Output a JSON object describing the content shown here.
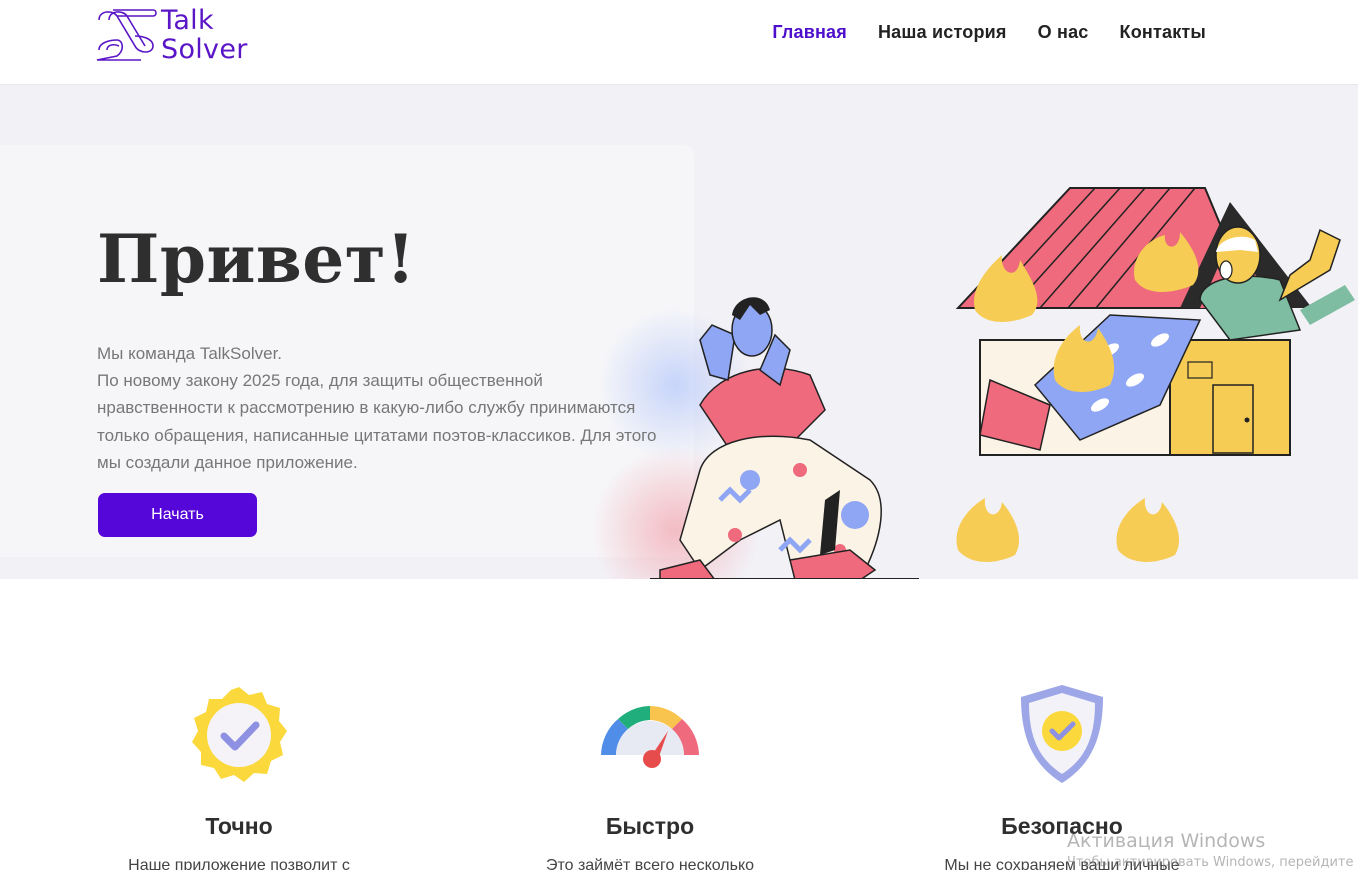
{
  "header": {
    "logo_line1": "Talk",
    "logo_line2": "Solver",
    "nav": [
      {
        "label": "Главная",
        "active": true
      },
      {
        "label": "Наша история",
        "active": false
      },
      {
        "label": "О нас",
        "active": false
      },
      {
        "label": "Контакты",
        "active": false
      }
    ]
  },
  "hero": {
    "title": "Привет!",
    "line1": "Мы команда TalkSolver.",
    "line2": "По новому закону 2025 года, для защиты общественной нравственности к рассмотрению в какую-либо службу принимаются только обращения, написанные цитатами поэтов-классиков. Для этого мы создали данное приложение.",
    "button": "Начать",
    "illustration": "person-running-from-burning-house"
  },
  "features": [
    {
      "icon": "verified-badge-icon",
      "title": "Точно",
      "text": "Наше приложение позволит с"
    },
    {
      "icon": "speedometer-icon",
      "title": "Быстро",
      "text": "Это займёт всего несколько"
    },
    {
      "icon": "shield-check-icon",
      "title": "Безопасно",
      "text": "Мы не сохраняем ваши личные"
    }
  ],
  "watermark": {
    "title": "Активация Windows",
    "subtitle": "Чтобы активировать Windows, перейдите"
  },
  "colors": {
    "brand": "#5a16c6",
    "button": "#5506d8",
    "hero_bg": "#f2f1f6"
  }
}
